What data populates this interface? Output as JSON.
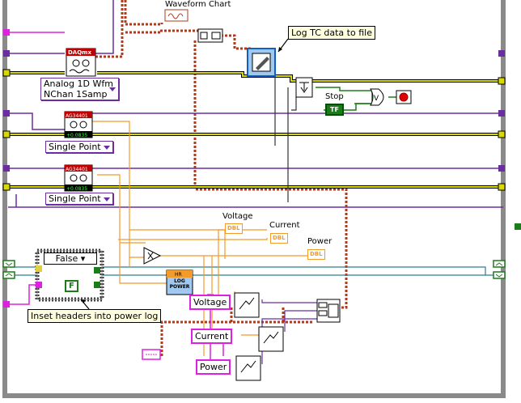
{
  "diagram": {
    "waveform_chart_label": "Waveform Chart",
    "comment_log_tc": "Log TC data to file",
    "daqmx_header": "DAQmx",
    "daqmx_ring": "Analog 1D Wfm\nNChan 1Samp",
    "ag_header": "AG34401",
    "ag_value": "+0.0835",
    "ag1_ring": "Single Point",
    "ag2_ring": "Single Point",
    "stop_label": "Stop",
    "stop_constant": "TF",
    "case_selector": "False",
    "false_constant": "F",
    "comment_inset": "Inset headers into power log",
    "voltage_label": "Voltage",
    "current_label": "Current",
    "power_label": "Power",
    "dbl_tag": "DBL",
    "hr_header": "HR",
    "log_power_text": "LOG\nPOWER",
    "bundle_voltage": "Voltage",
    "bundle_current": "Current",
    "bundle_power": "Power",
    "colors": {
      "loop_border": "#8a8a8a",
      "error_wire": "#b23a1a",
      "numeric_wire": "#f29a2a",
      "boolean_wire": "#1c7c1c",
      "string_wire": "#e020e0",
      "class_wire": "#6a2ea0",
      "dynamic_wire": "#2a7f8f",
      "yellow_wire": "#d9d900"
    }
  }
}
